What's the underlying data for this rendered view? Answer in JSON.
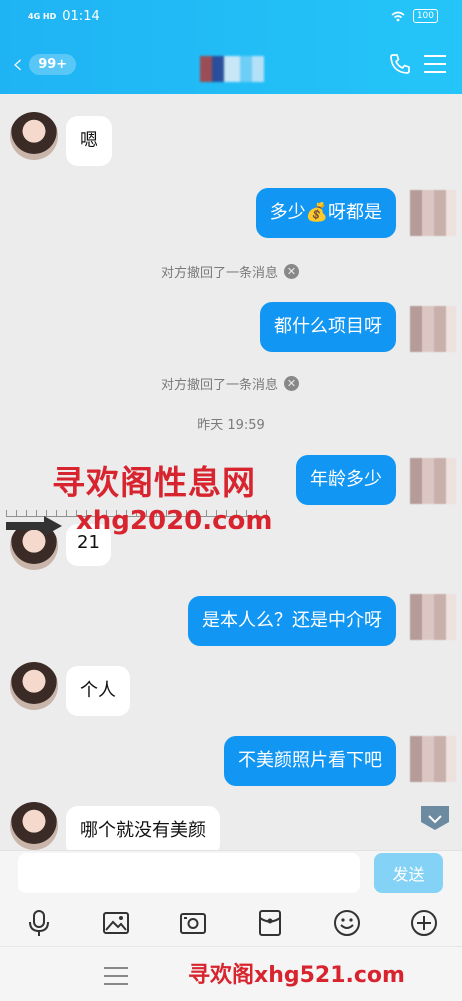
{
  "status_bar": {
    "network": "4G HD",
    "time": "01:14",
    "battery": "100"
  },
  "header": {
    "unread_count": "99+"
  },
  "messages": [
    {
      "side": "left",
      "text": "嗯"
    },
    {
      "side": "right",
      "text": "多少💰呀都是"
    },
    {
      "type": "system",
      "text": "对方撤回了一条消息"
    },
    {
      "side": "right",
      "text": "都什么项目呀"
    },
    {
      "type": "system",
      "text": "对方撤回了一条消息"
    },
    {
      "type": "time",
      "text": "昨天 19:59"
    },
    {
      "side": "right",
      "text": "年龄多少"
    },
    {
      "side": "left",
      "text": "21"
    },
    {
      "side": "right",
      "text": "是本人么？还是中介呀"
    },
    {
      "side": "left",
      "text": "个人"
    },
    {
      "side": "right",
      "text": "不美颜照片看下吧"
    },
    {
      "side": "left",
      "text": "哪个就没有美颜"
    }
  ],
  "watermark": {
    "title": "寻欢阁性息网",
    "url": "xhg2020.com",
    "footer": "寻欢阁xhg521.com"
  },
  "input": {
    "value": "",
    "send_label": "发送"
  },
  "toolbar": {
    "icons": [
      "microphone-icon",
      "photo-icon",
      "camera-icon",
      "red-packet-icon",
      "emoji-icon",
      "plus-icon"
    ]
  },
  "colors": {
    "header": "#1fb3f4",
    "outgoing_bubble": "#1296f3",
    "incoming_bubble": "#ffffff",
    "send_button": "#84d2f6",
    "watermark": "#d8242e"
  }
}
